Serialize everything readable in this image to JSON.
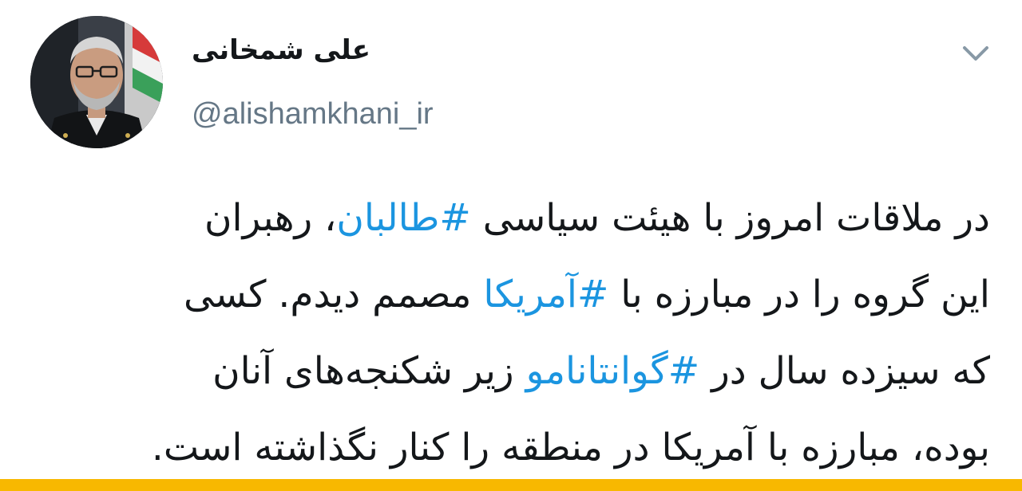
{
  "author": {
    "display_name": "علی شمخانی",
    "handle": "@alishamkhani_ir"
  },
  "tweet": {
    "lines": [
      {
        "before": "در ملاقات امروز با هیئت سیاسی ",
        "hashtag": "#طالبان",
        "after": "، رهبران"
      },
      {
        "before": "این گروه را در مبارزه با ",
        "hashtag": "#آمریکا",
        "after": " مصمم دیدم. کسی"
      },
      {
        "before": "که سیزده سال در ",
        "hashtag": "#گوانتانامو",
        "after": " زیر شکنجه‌های آنان"
      },
      {
        "before": "بوده، مبارزه با آمریکا در منطقه را کنار نگذاشته است.",
        "hashtag": "",
        "after": ""
      }
    ]
  },
  "icons": {
    "menu": "chevron-down-icon"
  },
  "colors": {
    "hashtag": "#1b95e0",
    "text": "#14171a",
    "handle": "#657786",
    "bottom_bar": "#f8b800"
  }
}
